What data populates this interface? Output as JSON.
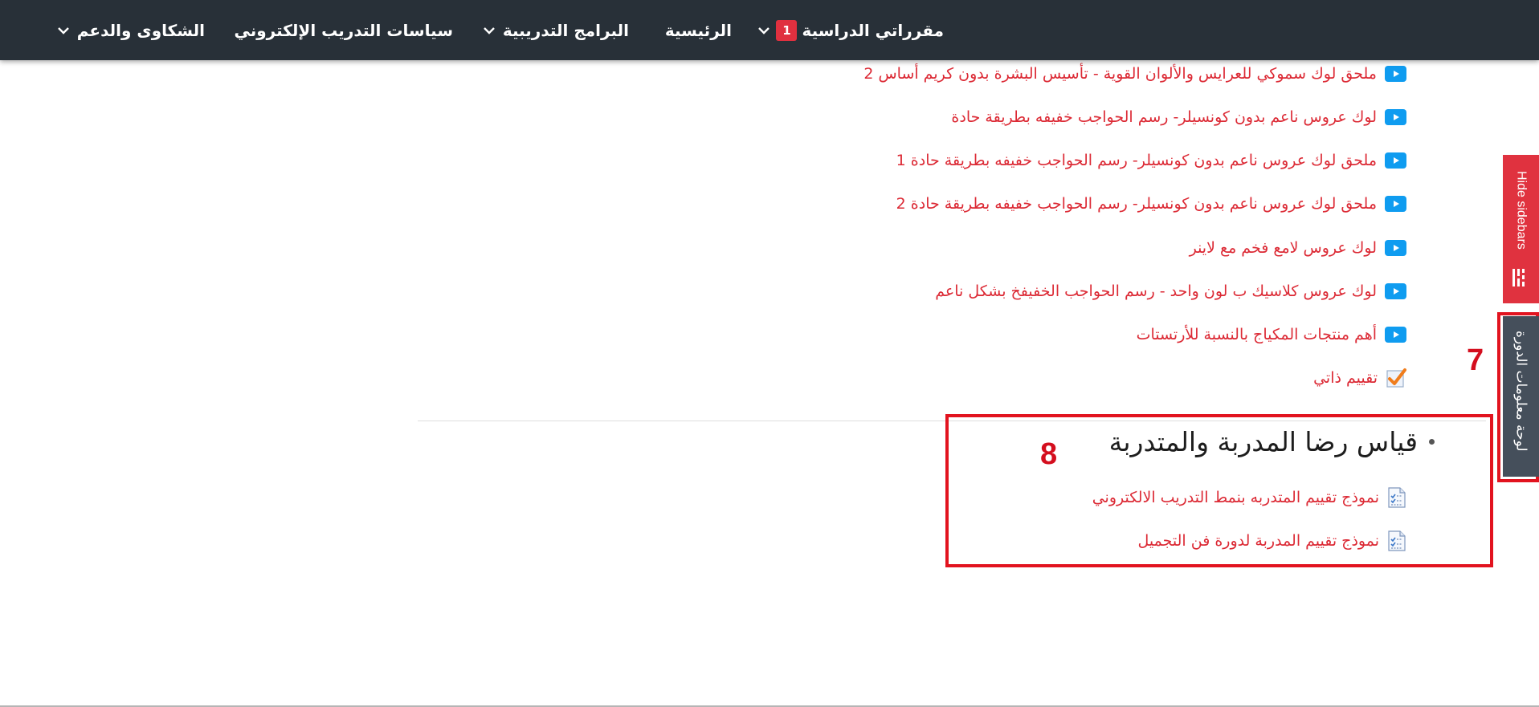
{
  "navbar": {
    "items": [
      {
        "label": "مقرراتي الدراسية",
        "badge": "1",
        "has_dropdown": true
      },
      {
        "label": "الرئيسية",
        "has_dropdown": false
      },
      {
        "label": "البرامج التدريبية",
        "has_dropdown": true
      },
      {
        "label": "سياسات التدريب الإلكتروني",
        "has_dropdown": false
      },
      {
        "label": "الشكاوى والدعم",
        "has_dropdown": true
      }
    ]
  },
  "activities": [
    {
      "label": "ملحق لوك سموكي للعرايس والألوان القوية - تأسيس البشرة بدون كريم أساس 2",
      "icon": "video-icon"
    },
    {
      "label": "لوك عروس ناعم بدون كونسيلر- رسم الحواجب خفيفه بطريقة حادة",
      "icon": "video-icon"
    },
    {
      "label": "ملحق لوك عروس ناعم بدون كونسيلر- رسم الحواجب خفيفه بطريقة حادة 1",
      "icon": "video-icon"
    },
    {
      "label": "ملحق لوك عروس ناعم بدون كونسيلر- رسم الحواجب خفيفه بطريقة حادة 2",
      "icon": "video-icon"
    },
    {
      "label": "لوك عروس لامع فخم مع لاينر",
      "icon": "video-icon"
    },
    {
      "label": "لوك عروس كلاسيك ب لون واحد - رسم الحواجب الخفيفخ بشكل ناعم",
      "icon": "video-icon"
    },
    {
      "label": "أهم منتجات المكياج بالنسبة للأرتستات",
      "icon": "video-icon"
    },
    {
      "label": "تقييم ذاتي",
      "icon": "checkmark-quiz-icon"
    }
  ],
  "section": {
    "title": "قياس رضا المدربة والمتدربة",
    "items": [
      {
        "label": "نموذج تقييم المتدربه بنمط التدريب الالكتروني",
        "icon": "feedback-form-icon"
      },
      {
        "label": "نموذج تقييم المدربة لدورة فن التجميل",
        "icon": "feedback-form-icon"
      }
    ]
  },
  "sidebar_tabs": {
    "hide_label": "Hide sidebars",
    "course_info_label": "لوحة معلومات الدورة"
  },
  "annotations": {
    "box_7": "7",
    "box_8": "8"
  },
  "colors": {
    "navbar_bg": "#283038",
    "link_red": "#dc2a35",
    "video_blue": "#0f9cf0",
    "hide_tab_red": "#e0323f",
    "info_tab_gray": "#454f5b",
    "annotation_red": "#e2131f"
  }
}
